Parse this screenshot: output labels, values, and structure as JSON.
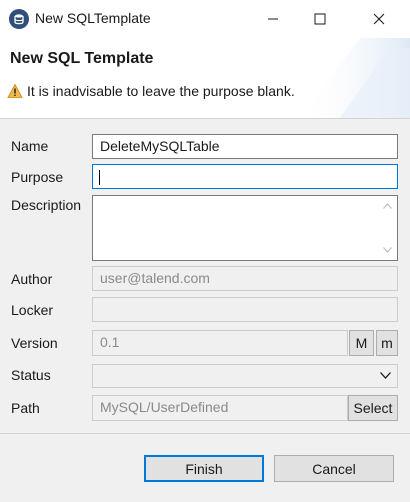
{
  "window": {
    "title": "New SQLTemplate",
    "controls": {
      "minimize_icon": "minimize-icon",
      "maximize_icon": "maximize-icon",
      "close_icon": "close-icon"
    }
  },
  "banner": {
    "title": "New SQL Template",
    "message": "It is inadvisable to leave the purpose blank.",
    "message_icon": "warning-icon"
  },
  "form": {
    "name": {
      "label": "Name",
      "value": "DeleteMySQLTable"
    },
    "purpose": {
      "label": "Purpose",
      "value": ""
    },
    "description": {
      "label": "Description",
      "value": ""
    },
    "author": {
      "label": "Author",
      "value": "user@talend.com"
    },
    "locker": {
      "label": "Locker",
      "value": ""
    },
    "version": {
      "label": "Version",
      "value": "0.1",
      "major_button": "M",
      "minor_button": "m"
    },
    "status": {
      "label": "Status",
      "value": ""
    },
    "path": {
      "label": "Path",
      "value": "MySQL/UserDefined",
      "select_button": "Select"
    }
  },
  "buttons": {
    "finish": "Finish",
    "cancel": "Cancel"
  },
  "colors": {
    "accent": "#0078d7",
    "warning": "#f2b84b",
    "title_icon": "#2f4f7a"
  }
}
